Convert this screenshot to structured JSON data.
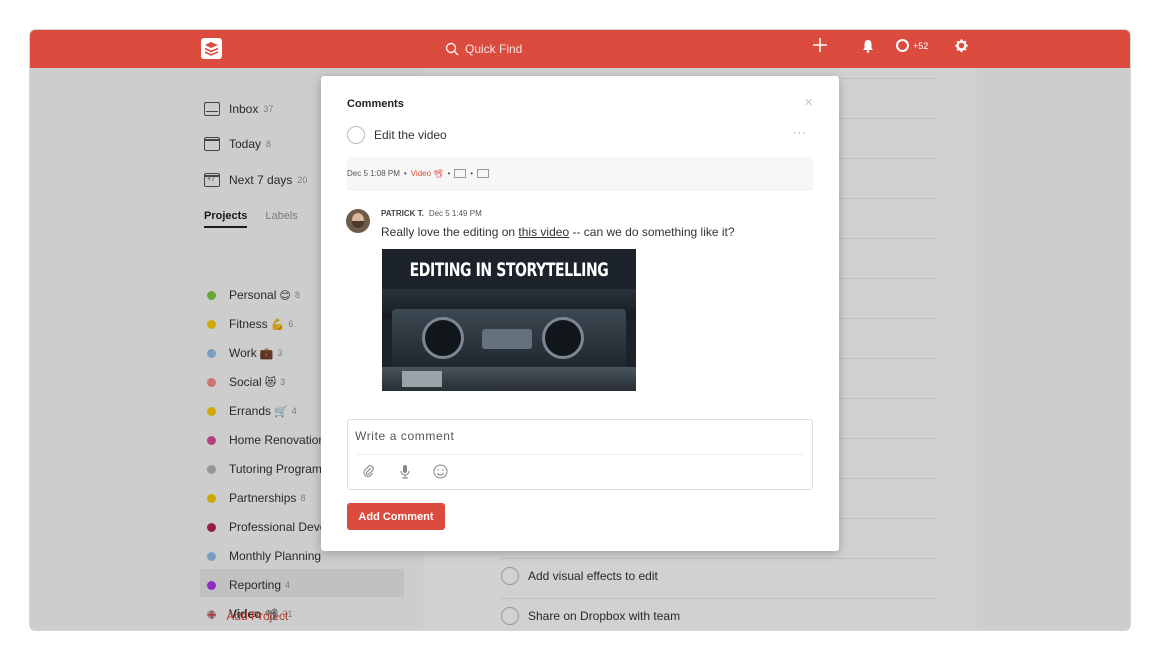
{
  "topbar": {
    "search_placeholder": "Quick Find",
    "karma_value": "+52"
  },
  "nav": [
    {
      "label": "Inbox",
      "count": "37",
      "icon": "inbox-icon"
    },
    {
      "label": "Today",
      "count": "8",
      "icon": "calendar-icon"
    },
    {
      "label": "Next 7 days",
      "count": "20",
      "icon": "week-calendar-icon"
    }
  ],
  "tabs": {
    "projects": "Projects",
    "labels": "Labels"
  },
  "projects": [
    {
      "name": "Personal",
      "emoji": "😊",
      "count": "8",
      "color": "#7ecc49"
    },
    {
      "name": "Fitness",
      "emoji": "💪",
      "count": "6",
      "color": "#fad000"
    },
    {
      "name": "Work",
      "emoji": "💼",
      "count": "3",
      "color": "#96c3eb"
    },
    {
      "name": "Social",
      "emoji": "😻",
      "count": "3",
      "color": "#ff8d85"
    },
    {
      "name": "Errands",
      "emoji": "🛒",
      "count": "4",
      "color": "#ffcc00"
    },
    {
      "name": "Home Renovation",
      "emoji": "",
      "count": "",
      "color": "#e05194"
    },
    {
      "name": "Tutoring Program",
      "emoji": "",
      "count": "",
      "color": "#b8b8b8"
    },
    {
      "name": "Partnerships",
      "emoji": "",
      "count": "8",
      "color": "#fad000"
    },
    {
      "name": "Professional Deve",
      "emoji": "",
      "count": "",
      "color": "#b8255f"
    },
    {
      "name": "Monthly Planning",
      "emoji": "",
      "count": "",
      "color": "#96c3eb"
    },
    {
      "name": "Reporting",
      "emoji": "",
      "count": "4",
      "color": "#af38eb"
    },
    {
      "name": "Video",
      "emoji": "📽",
      "count": "21",
      "color": "#b8b8b8"
    }
  ],
  "add_project_label": "Add Project",
  "tasks": [
    {
      "label": "Add visual effects to edit"
    },
    {
      "label": "Share on Dropbox with team"
    }
  ],
  "modal": {
    "title": "Comments",
    "close": "×",
    "task_name": "Edit the video",
    "more": "···",
    "meta_date": "Dec 5 1:08 PM",
    "meta_project": "Video 📽",
    "comment": {
      "author": "PATRICK T.",
      "date": "Dec 5 1:49 PM",
      "text_before": "Really love the editing on ",
      "link_text": "this video",
      "text_after": " -- can we do something like it?",
      "image_title": "EDITING IN STORYTELLING"
    },
    "input_placeholder": "Write a comment",
    "submit_label": "Add Comment"
  },
  "colors": {
    "brand": "#db4c3f"
  }
}
